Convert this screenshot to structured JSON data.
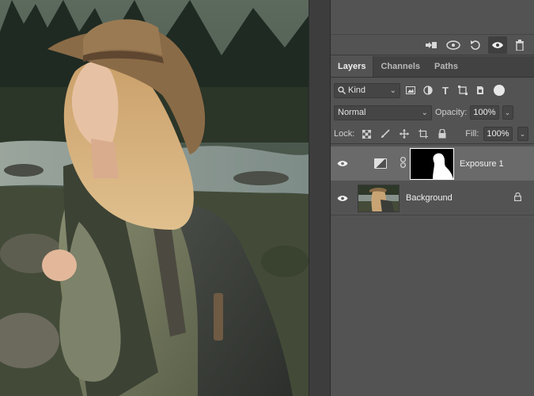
{
  "tabs": [
    "Layers",
    "Channels",
    "Paths"
  ],
  "filter": {
    "label": "Kind"
  },
  "blend": {
    "mode": "Normal",
    "opacity_label": "Opacity:",
    "opacity_value": "100%"
  },
  "lock": {
    "label": "Lock:",
    "fill_label": "Fill:",
    "fill_value": "100%"
  },
  "layers": [
    {
      "name": "Exposure 1",
      "type": "adjustment",
      "selected": true,
      "visible": true
    },
    {
      "name": "Background",
      "type": "pixel",
      "locked": true,
      "visible": true
    }
  ],
  "icons": {
    "toolbar": [
      "link-layers-icon",
      "visibility-toggle-icon",
      "reset-icon",
      "eye-icon",
      "trash-icon"
    ],
    "filters": [
      "pixel-filter-icon",
      "adjustment-filter-icon",
      "type-filter-icon",
      "shape-filter-icon",
      "smart-object-filter-icon"
    ],
    "locks": [
      "lock-transparent-icon",
      "lock-brush-icon",
      "lock-position-icon",
      "lock-artboard-icon",
      "lock-all-icon"
    ]
  },
  "colors": {
    "panel_bg": "#535353",
    "selected_layer_bg": "#6a6a6a",
    "tab_bar_bg": "#424242"
  }
}
